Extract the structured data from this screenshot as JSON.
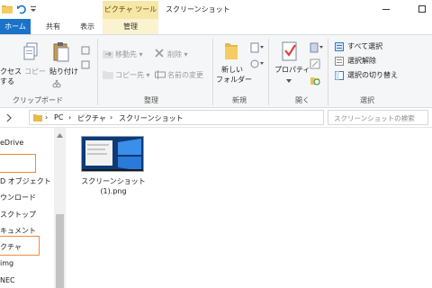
{
  "window": {
    "title": "スクリーンショット",
    "context_tab_header": "ピクチャ ツール"
  },
  "tabs": [
    "ホーム",
    "共有",
    "表示",
    "管理"
  ],
  "ribbon": {
    "clipboard": {
      "access_label_1": "クセス",
      "access_label_2": "する",
      "copy": "コピー",
      "paste": "貼り付け",
      "group": "クリップボード"
    },
    "organize": {
      "move_to": "移動先",
      "copy_to": "コピー先",
      "delete": "削除",
      "rename": "名前の変更",
      "group": "整理"
    },
    "new": {
      "new_folder_1": "新しい",
      "new_folder_2": "フォルダー",
      "group": "新規"
    },
    "open": {
      "properties": "プロパティ",
      "group": "開く"
    },
    "select": {
      "select_all": "すべて選択",
      "select_none": "選択解除",
      "invert": "選択の切り替え",
      "group": "選択"
    }
  },
  "address": {
    "crumbs": [
      "PC",
      "ピクチャ",
      "スクリーンショット"
    ],
    "search_placeholder": "スクリーンショットの検索"
  },
  "nav": {
    "items": [
      "eDrive",
      "",
      "D オブジェクト",
      "ウンロード",
      "スクトップ",
      "キュメント",
      "クチャ",
      "img",
      "NEC"
    ]
  },
  "files": [
    {
      "name_line1": "スクリーンショット",
      "name_line2": "(1).png"
    }
  ],
  "colors": {
    "accent": "#1a73c8",
    "context_tab": "#f6e7a6",
    "highlight": "#f08a3a"
  }
}
